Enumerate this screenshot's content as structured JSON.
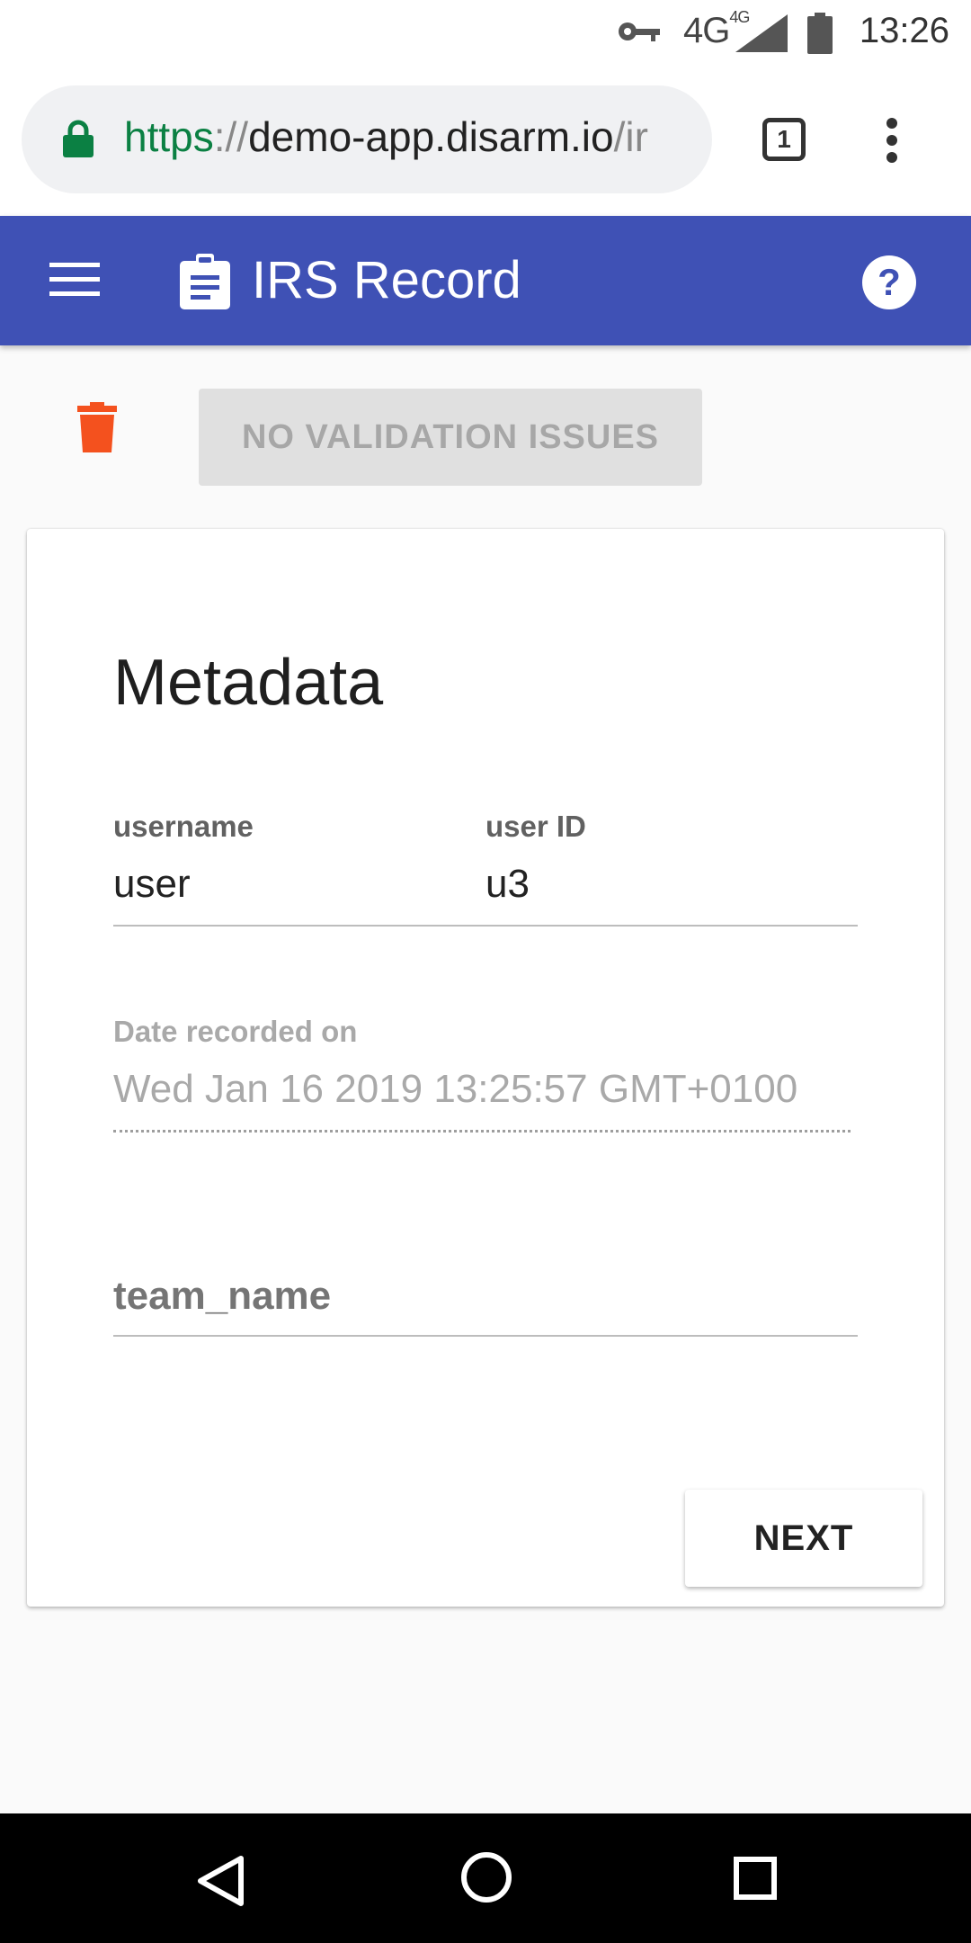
{
  "status_bar": {
    "network": "4G",
    "network_sup": "4G",
    "time": "13:26",
    "icons": [
      "key-icon",
      "signal-icon",
      "battery-icon"
    ]
  },
  "browser": {
    "url_scheme": "https",
    "url_sep": "://",
    "url_host": "demo-app.disarm.io",
    "url_path": "/ir",
    "tab_count": "1"
  },
  "app_bar": {
    "title": "IRS Record",
    "color": "#3f51b5"
  },
  "actions": {
    "validation_label": "NO VALIDATION ISSUES",
    "trash_color": "#f4511e"
  },
  "form": {
    "section_title": "Metadata",
    "username_label": "username",
    "username_value": "user",
    "user_id_label": "user ID",
    "user_id_value": "u3",
    "date_label": "Date recorded on",
    "date_value": "Wed Jan 16 2019 13:25:57 GMT+0100",
    "team_name_label": "team_name",
    "next_label": "NEXT"
  }
}
